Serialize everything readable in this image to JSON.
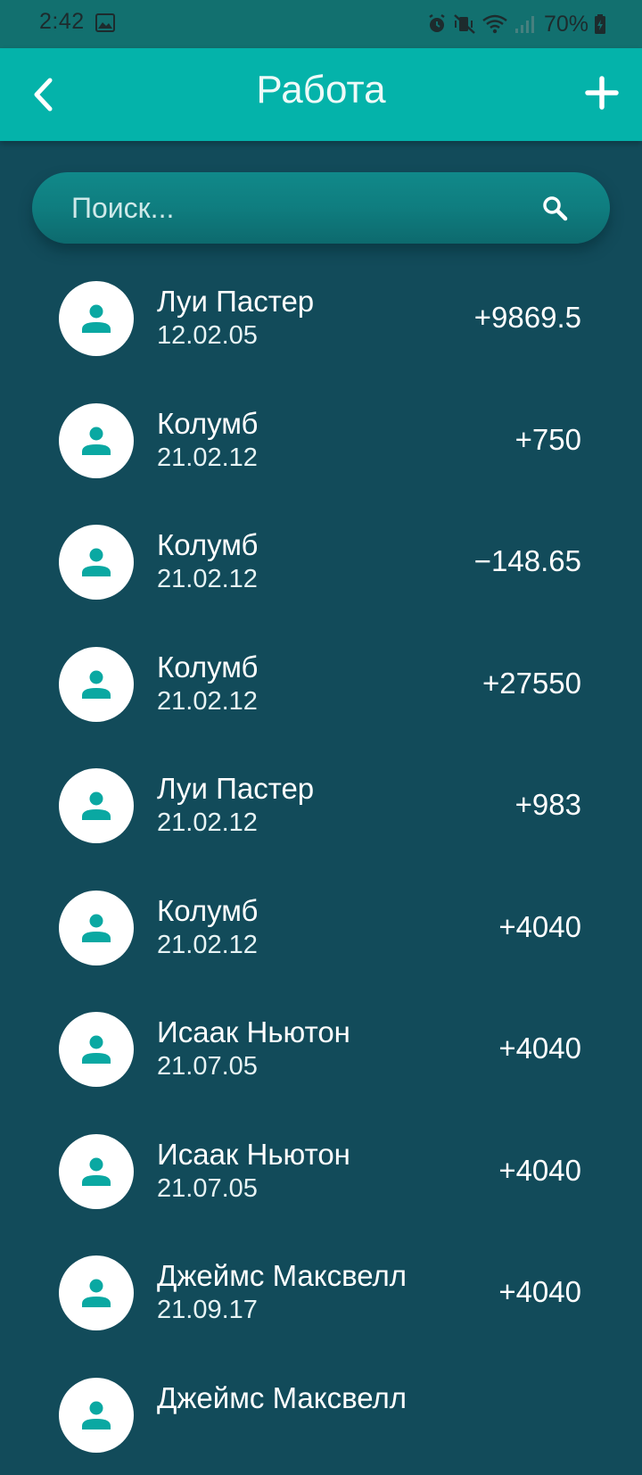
{
  "status_bar": {
    "time": "2:42",
    "battery": "70%",
    "icons": [
      "image-icon",
      "alarm-icon",
      "vibrate-icon",
      "wifi-icon",
      "signal-icon",
      "battery-icon"
    ]
  },
  "header": {
    "title": "Работа",
    "back_icon": "chevron-left-icon",
    "add_icon": "plus-icon"
  },
  "search": {
    "placeholder": "Поиск...",
    "value": "",
    "icon": "search-icon"
  },
  "colors": {
    "background": "#124b5a",
    "app_bar": "#04b3aa",
    "status_bar": "#12706f",
    "avatar_icon": "#0aa8a2"
  },
  "transactions": [
    {
      "name": "Луи Пастер",
      "date": "12.02.05",
      "amount": "+9869.5"
    },
    {
      "name": "Колумб",
      "date": "21.02.12",
      "amount": "+750"
    },
    {
      "name": "Колумб",
      "date": "21.02.12",
      "amount": "−148.65"
    },
    {
      "name": "Колумб",
      "date": "21.02.12",
      "amount": "+27550"
    },
    {
      "name": "Луи Пастер",
      "date": "21.02.12",
      "amount": "+983"
    },
    {
      "name": "Колумб",
      "date": "21.02.12",
      "amount": "+4040"
    },
    {
      "name": "Исаак Ньютон",
      "date": "21.07.05",
      "amount": "+4040"
    },
    {
      "name": "Исаак Ньютон",
      "date": "21.07.05",
      "amount": "+4040"
    },
    {
      "name": "Джеймс Максвелл",
      "date": "21.09.17",
      "amount": "+4040"
    },
    {
      "name": "Джеймс Максвелл",
      "date": "",
      "amount": ""
    }
  ]
}
